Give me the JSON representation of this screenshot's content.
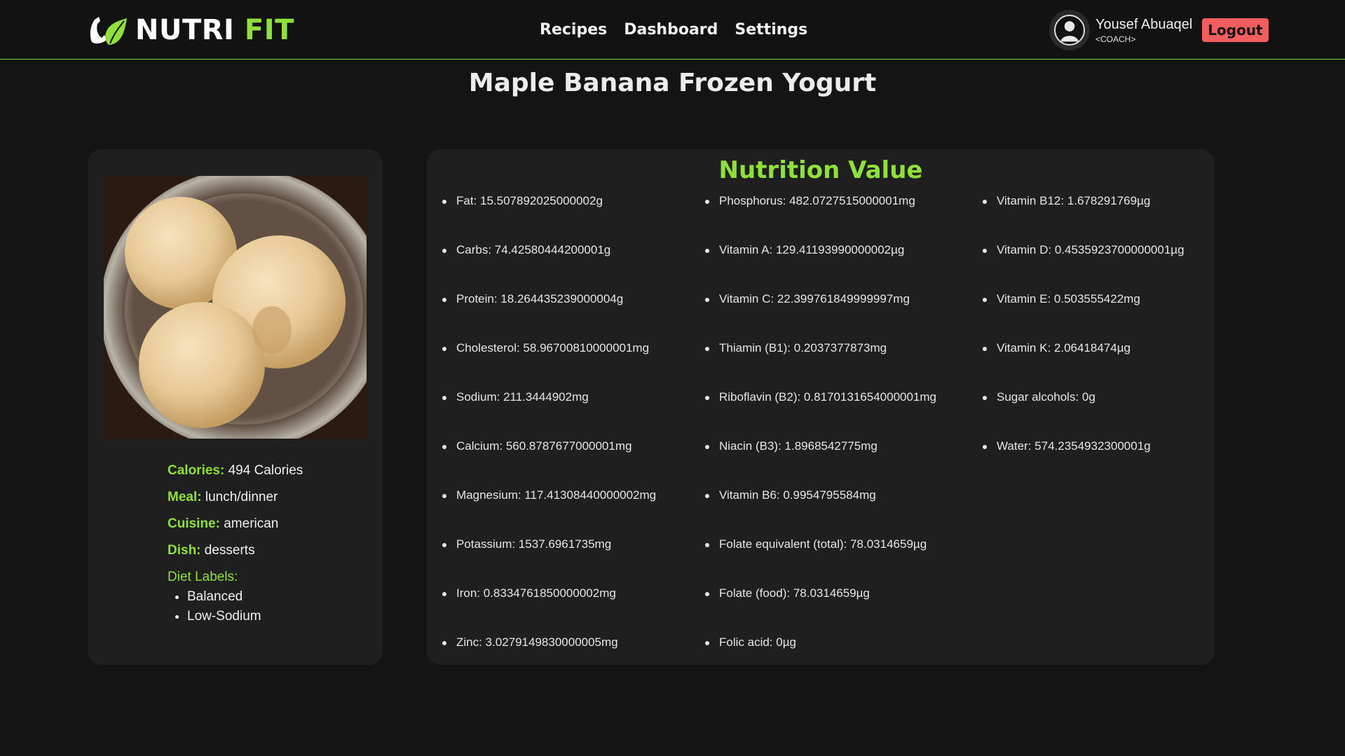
{
  "brand": {
    "name_part1": "NUTRI",
    "name_part2": "FIT"
  },
  "nav": {
    "items": [
      "Recipes",
      "Dashboard",
      "Settings"
    ]
  },
  "user": {
    "name": "Yousef Abuaqel",
    "role": "<COACH>",
    "logout_label": "Logout"
  },
  "recipe": {
    "title": "Maple Banana Frozen Yogurt",
    "calories_label": "Calories:",
    "calories_value": "494 Calories",
    "meal_label": "Meal:",
    "meal_value": "lunch/dinner",
    "cuisine_label": "Cuisine:",
    "cuisine_value": "american",
    "dish_label": "Dish:",
    "dish_value": "desserts",
    "diet_labels_title": "Diet Labels:",
    "diet_labels": [
      "Balanced",
      "Low-Sodium"
    ]
  },
  "nutrition": {
    "title": "Nutrition Value",
    "col1": [
      "Fat: 15.507892025000002g",
      "Carbs: 74.42580444200001g",
      "Protein: 18.264435239000004g",
      "Cholesterol: 58.96700810000001mg",
      "Sodium: 211.3444902mg",
      "Calcium: 560.8787677000001mg",
      "Magnesium: 117.41308440000002mg",
      "Potassium: 1537.6961735mg",
      "Iron: 0.8334761850000002mg",
      "Zinc: 3.0279149830000005mg"
    ],
    "col2": [
      "Phosphorus: 482.0727515000001mg",
      "Vitamin A: 129.41193990000002µg",
      "Vitamin C: 22.399761849999997mg",
      "Thiamin (B1): 0.2037377873mg",
      "Riboflavin (B2): 0.8170131654000001mg",
      "Niacin (B3): 1.8968542775mg",
      "Vitamin B6: 0.9954795584mg",
      "Folate equivalent (total): 78.0314659µg",
      "Folate (food): 78.0314659µg",
      "Folic acid: 0µg"
    ],
    "col3": [
      "Vitamin B12: 1.678291769µg",
      "Vitamin D: 0.4535923700000001µg",
      "Vitamin E: 0.503555422mg",
      "Vitamin K: 2.06418474µg",
      "Sugar alcohols: 0g",
      "Water: 574.2354932300001g"
    ]
  },
  "colors": {
    "accent": "#8fe03a",
    "logout": "#f25d5d",
    "background": "#141414",
    "card": "#1f1f1f"
  }
}
